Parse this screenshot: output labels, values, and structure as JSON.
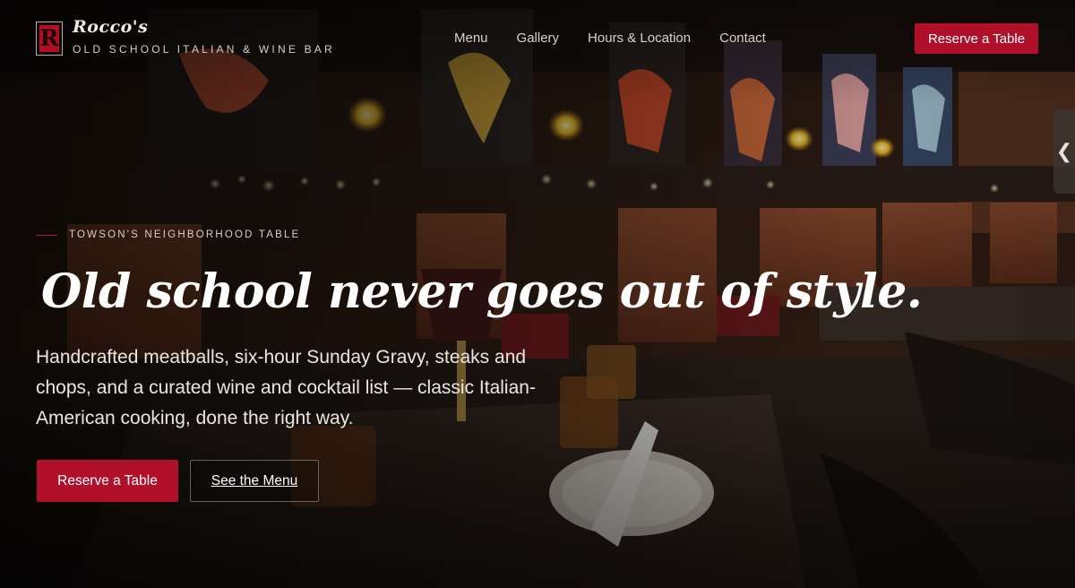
{
  "brand": {
    "mark_letter": "R",
    "name": "Rocco's",
    "tagline": "OLD SCHOOL ITALIAN & WINE BAR",
    "accent_color": "#b0102a"
  },
  "nav": {
    "items": [
      {
        "label": "Menu"
      },
      {
        "label": "Gallery"
      },
      {
        "label": "Hours & Location"
      },
      {
        "label": "Contact"
      }
    ],
    "cta_label": "Reserve a Table"
  },
  "side_tab": {
    "icon": "chevron-left-icon",
    "glyph": "❮"
  },
  "hero": {
    "eyebrow": "TOWSON'S NEIGHBORHOOD TABLE",
    "headline": "Old school never goes out of style.",
    "lede": "Handcrafted meatballs, six-hour Sunday Gravy, steaks and chops, and a curated wine and cocktail list — classic Italian-American cooking, done the right way.",
    "primary_cta": "Reserve a Table",
    "secondary_cta": "See the Menu",
    "background_image": "restaurant-dining-room-photo"
  }
}
